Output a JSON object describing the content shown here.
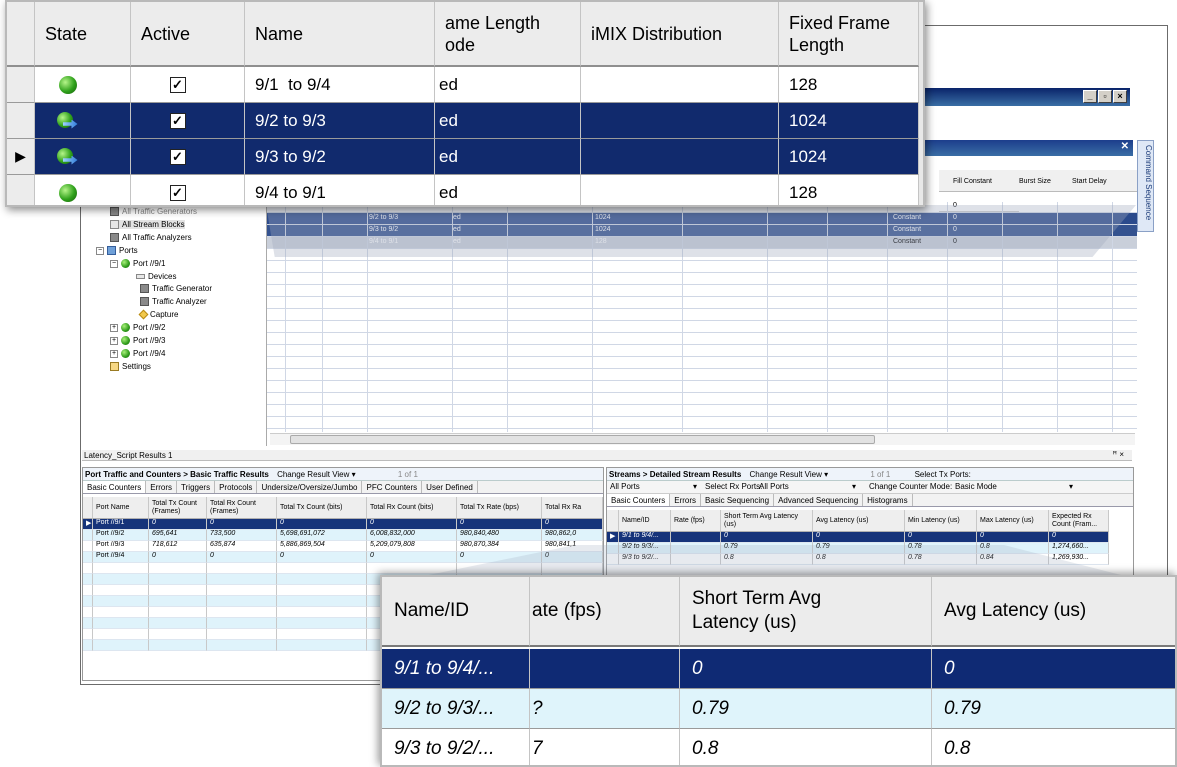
{
  "window": {
    "min": "_",
    "max": "▫",
    "close": "×"
  },
  "side_tab": "Command Sequence",
  "upper_grid": {
    "visible_headers": [
      "Fill Constant",
      "Burst Size",
      "Start Delay"
    ],
    "rows": [
      {
        "name": "9/2 to 9/3",
        "mode": "ed",
        "len": "1024",
        "fill": "Constant",
        "val": "0"
      },
      {
        "name": "9/3 to 9/2",
        "mode": "ed",
        "len": "1024",
        "fill": "Constant",
        "val": "0"
      },
      {
        "name": "9/4 to 9/1",
        "mode": "ed",
        "len": "128",
        "fill": "Constant",
        "val": "0"
      }
    ],
    "top_val": "0"
  },
  "tree": {
    "items": [
      "All Traffic Generators",
      "All Stream Blocks",
      "All Traffic Analyzers",
      "Ports",
      "Port //9/1",
      "Devices",
      "Traffic Generator",
      "Traffic Analyzer",
      "Capture",
      "Port //9/2",
      "Port //9/3",
      "Port //9/4",
      "Settings"
    ]
  },
  "results_bar": {
    "title": "Latency_Script Results 1",
    "pin": "ꟸ ×"
  },
  "left_panel": {
    "title": "Port Traffic and Counters > Basic Traffic Results",
    "change_view": "Change Result View ▾",
    "pager": "1 of 1",
    "tabs": [
      "Basic Counters",
      "Errors",
      "Triggers",
      "Protocols",
      "Undersize/Oversize/Jumbo",
      "PFC Counters",
      "User Defined"
    ],
    "headers": [
      "Port Name",
      "Total Tx Count (Frames)",
      "Total Rx Count (Frames)",
      "Total Tx Count (bits)",
      "Total Rx Count (bits)",
      "Total Tx Rate (bps)",
      "Total Rx Ra"
    ],
    "rows": [
      [
        "Port //9/1",
        "0",
        "0",
        "0",
        "0",
        "0",
        "0"
      ],
      [
        "Port //9/2",
        "695,641",
        "733,500",
        "5,698,691,072",
        "6,008,832,000",
        "980,840,480",
        "980,862,0"
      ],
      [
        "Port //9/3",
        "718,612",
        "635,874",
        "5,886,869,504",
        "5,209,079,808",
        "980,870,384",
        "980,841,1"
      ],
      [
        "Port //9/4",
        "0",
        "0",
        "0",
        "0",
        "0",
        "0"
      ]
    ]
  },
  "right_panel": {
    "title": "Streams > Detailed Stream Results",
    "change_view": "Change Result View ▾",
    "pager": "1 of 1",
    "select_tx": "Select Tx Ports:",
    "all_ports": "All Ports",
    "select_rx": "Select Rx Ports:",
    "all_ports2": "All Ports",
    "counter_mode_label": "Change Counter Mode:",
    "counter_mode": "Basic Mode",
    "tabs": [
      "Basic Counters",
      "Errors",
      "Basic Sequencing",
      "Advanced Sequencing",
      "Histograms"
    ],
    "headers": [
      "Name/ID",
      "Rate (fps)",
      "Short Term Avg Latency (us)",
      "Avg Latency (us)",
      "Min Latency (us)",
      "Max Latency (us)",
      "Expected Rx Count (Fram..."
    ],
    "rows": [
      [
        "9/1 to 9/4/...",
        "",
        "0",
        "0",
        "0",
        "0",
        "0"
      ],
      [
        "9/2 to 9/3/...",
        "",
        "0.79",
        "0.79",
        "0.78",
        "0.8",
        "1,274,660..."
      ],
      [
        "9/3 to 9/2/...",
        "",
        "0.8",
        "0.8",
        "0.78",
        "0.84",
        "1,269,930..."
      ]
    ]
  },
  "magnifier_top": {
    "headers": [
      "State",
      "Active",
      "Name",
      "ame Length\node",
      "iMIX Distribution",
      "Fixed Frame\nLength"
    ],
    "rows": [
      {
        "state": "green",
        "active": "✓",
        "name": "9/1  to 9/4",
        "mode": "ed",
        "imix": "",
        "len": "128"
      },
      {
        "state": "tx",
        "active": "✓",
        "name": "9/2 to 9/3",
        "mode": "ed",
        "imix": "",
        "len": "1024"
      },
      {
        "state": "tx",
        "active": "✓",
        "name": "9/3 to 9/2",
        "mode": "ed",
        "imix": "",
        "len": "1024"
      },
      {
        "state": "green",
        "active": "✓",
        "name": "9/4 to 9/1",
        "mode": "ed",
        "imix": "",
        "len": "128"
      }
    ]
  },
  "magnifier_bottom": {
    "headers": [
      "Name/ID",
      "ate (fps)",
      "Short Term Avg\nLatency (us)",
      "Avg Latency (us)"
    ],
    "rows": [
      [
        "9/1  to 9/4/...",
        "",
        "0",
        "0"
      ],
      [
        "9/2 to 9/3/...",
        "?",
        "0.79",
        "0.79"
      ],
      [
        "9/3 to 9/2/...",
        "7",
        "0.8",
        "0.8"
      ]
    ]
  }
}
